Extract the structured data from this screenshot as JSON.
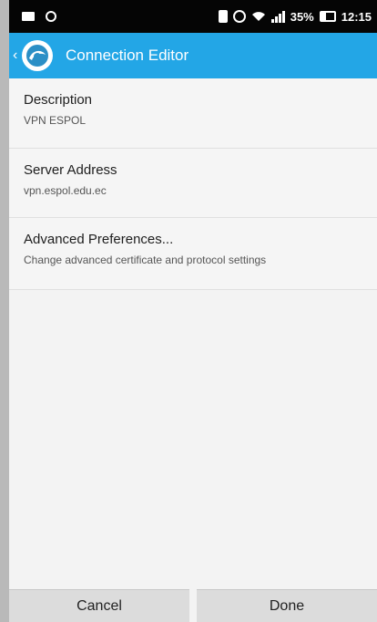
{
  "status_bar": {
    "battery_percent": "35%",
    "time": "12:15"
  },
  "app_bar": {
    "title": "Connection Editor"
  },
  "list": {
    "items": [
      {
        "title": "Description",
        "subtitle": "VPN ESPOL"
      },
      {
        "title": "Server Address",
        "subtitle": "vpn.espol.edu.ec"
      },
      {
        "title": "Advanced Preferences...",
        "subtitle": "Change advanced certificate and protocol settings"
      }
    ]
  },
  "buttons": {
    "cancel": "Cancel",
    "done": "Done"
  },
  "colors": {
    "app_bar": "#23a6e6",
    "status_bar": "#050505",
    "background": "#f3f3f3",
    "button": "#dcdcdc"
  }
}
